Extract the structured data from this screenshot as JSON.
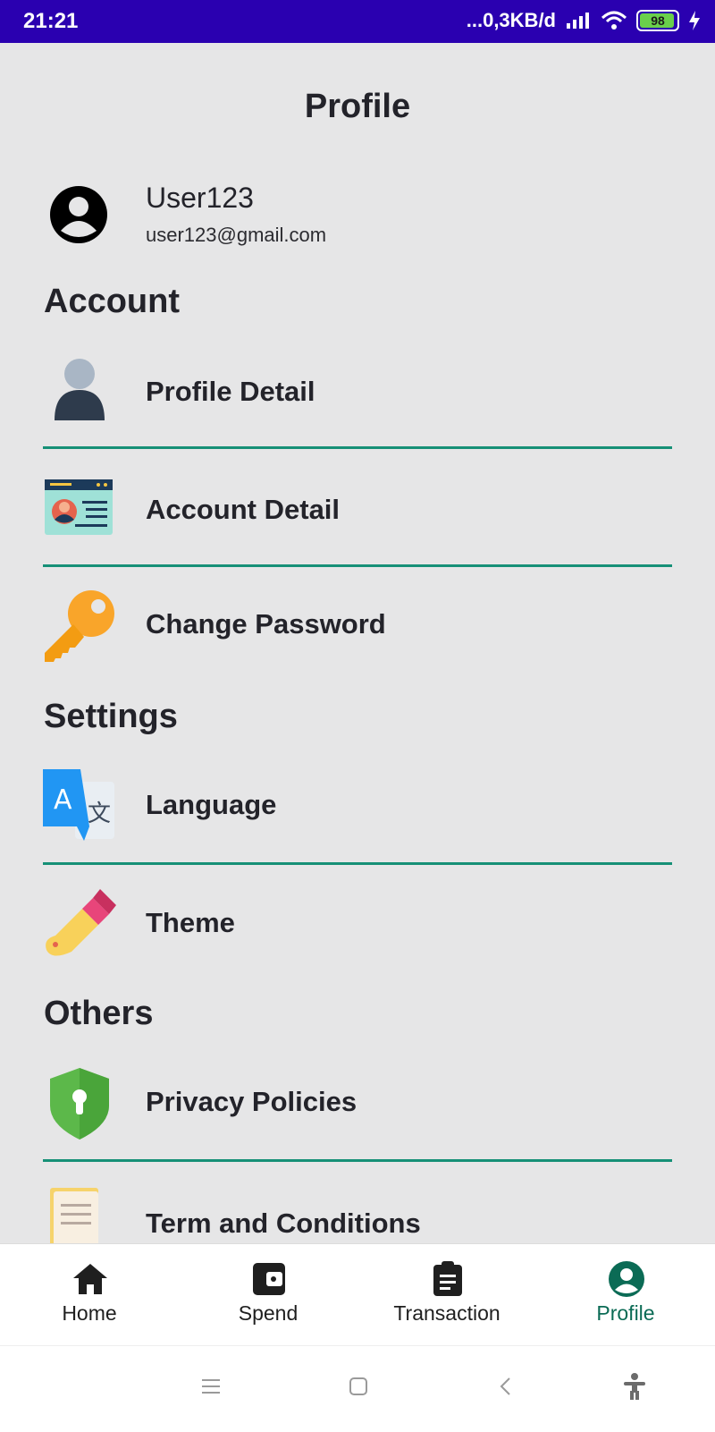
{
  "status": {
    "time": "21:21",
    "network": "...0,3KB/d",
    "battery": "98"
  },
  "page": {
    "title": "Profile"
  },
  "user": {
    "name": "User123",
    "email": "user123@gmail.com"
  },
  "sections": {
    "account": "Account",
    "settings": "Settings",
    "others": "Others"
  },
  "menu": {
    "profile_detail": "Profile Detail",
    "account_detail": "Account Detail",
    "change_password": "Change Password",
    "language": "Language",
    "theme": "Theme",
    "privacy": "Privacy Policies",
    "terms": "Term and Conditions"
  },
  "nav": {
    "home": "Home",
    "spend": "Spend",
    "transaction": "Transaction",
    "profile": "Profile"
  },
  "colors": {
    "accent": "#169077",
    "active_nav": "#0b6b55",
    "statusbar": "#2a00b0"
  }
}
